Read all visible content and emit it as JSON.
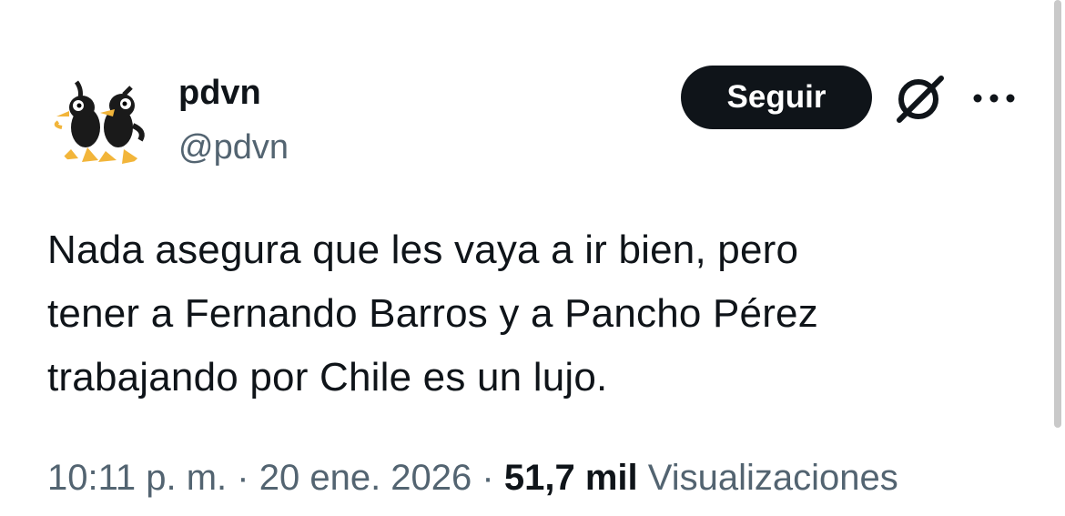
{
  "author": {
    "display_name": "pdvn",
    "handle": "@pdvn",
    "avatar_icon": "cartoon-crows-avatar"
  },
  "actions": {
    "follow_label": "Seguir",
    "grok_icon": "grok-icon",
    "more_icon": "more-horizontal-icon"
  },
  "tweet": {
    "lines": [
      "Nada asegura que les vaya a ir bien, pero",
      "tener a Fernando Barros y a Pancho Pérez",
      "trabajando por Chile es un lujo."
    ]
  },
  "meta": {
    "time": "10:11 p. m.",
    "separator": "·",
    "date": "20 ene. 2026",
    "views_count": "51,7 mil",
    "views_label": "Visualizaciones"
  },
  "colors": {
    "text_primary": "#0f1419",
    "text_secondary": "#536471",
    "button_bg": "#0f1419",
    "button_text": "#ffffff"
  }
}
